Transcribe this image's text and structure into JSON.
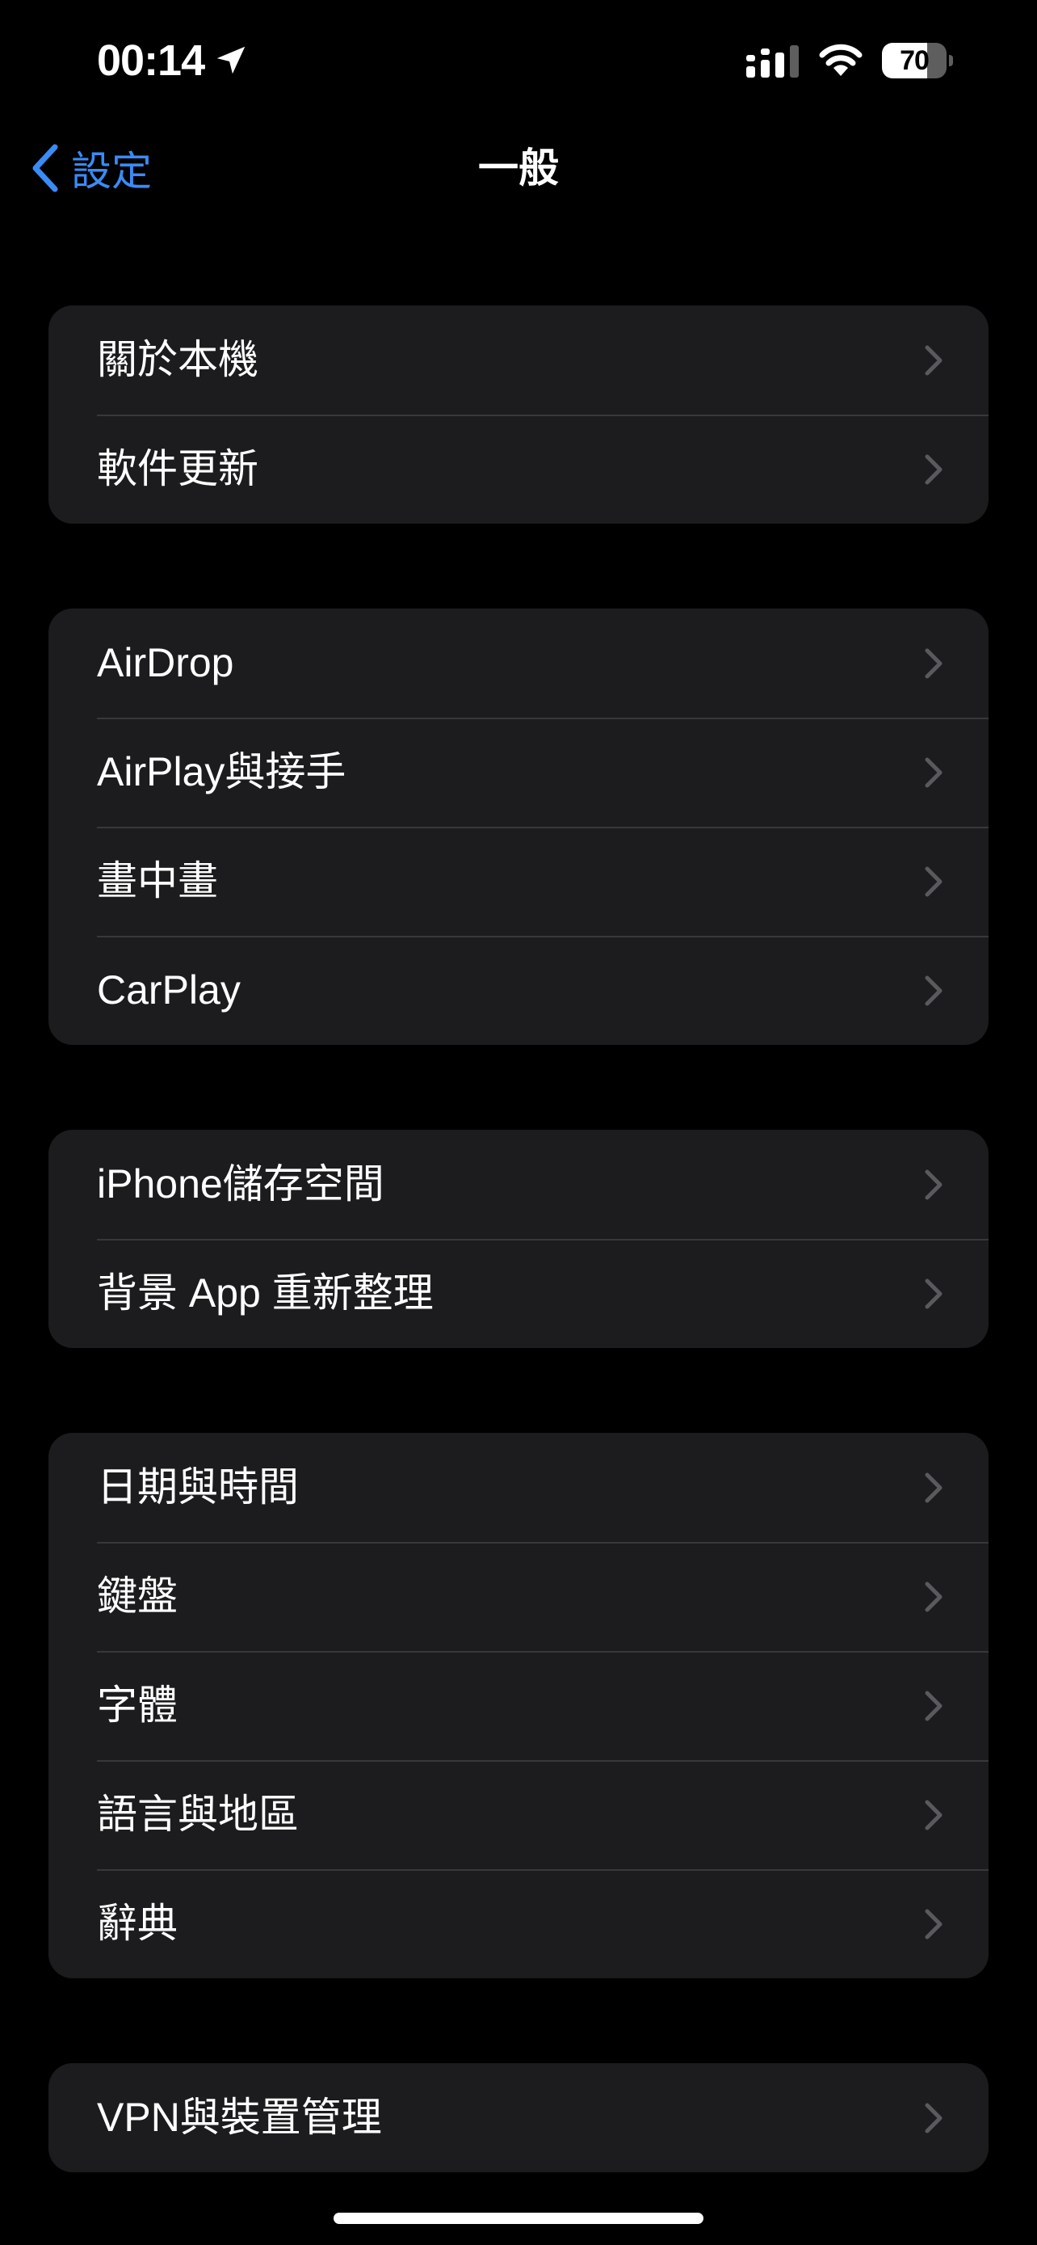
{
  "status_bar": {
    "time": "00:14",
    "battery_level": "70",
    "battery_fraction": 0.7,
    "icons": [
      "location-arrow-icon",
      "cellular-signal-icon",
      "wifi-icon",
      "battery-icon"
    ]
  },
  "nav": {
    "back_label": "設定",
    "title": "一般",
    "accent_color": "#3a8bf5"
  },
  "groups": [
    {
      "items": [
        {
          "label": "關於本機"
        },
        {
          "label": "軟件更新"
        }
      ]
    },
    {
      "items": [
        {
          "label": "AirDrop"
        },
        {
          "label": "AirPlay與接手"
        },
        {
          "label": "畫中畫"
        },
        {
          "label": "CarPlay"
        }
      ]
    },
    {
      "items": [
        {
          "label": "iPhone儲存空間"
        },
        {
          "label": "背景 App 重新整理"
        }
      ]
    },
    {
      "items": [
        {
          "label": "日期與時間"
        },
        {
          "label": "鍵盤"
        },
        {
          "label": "字體"
        },
        {
          "label": "語言與地區"
        },
        {
          "label": "辭典"
        }
      ]
    },
    {
      "items": [
        {
          "label": "VPN與裝置管理"
        }
      ]
    }
  ],
  "colors": {
    "background": "#000000",
    "group_background": "#1c1c1e",
    "separator": "#38383a",
    "chevron": "#5a5a5e",
    "text": "#ffffff"
  }
}
